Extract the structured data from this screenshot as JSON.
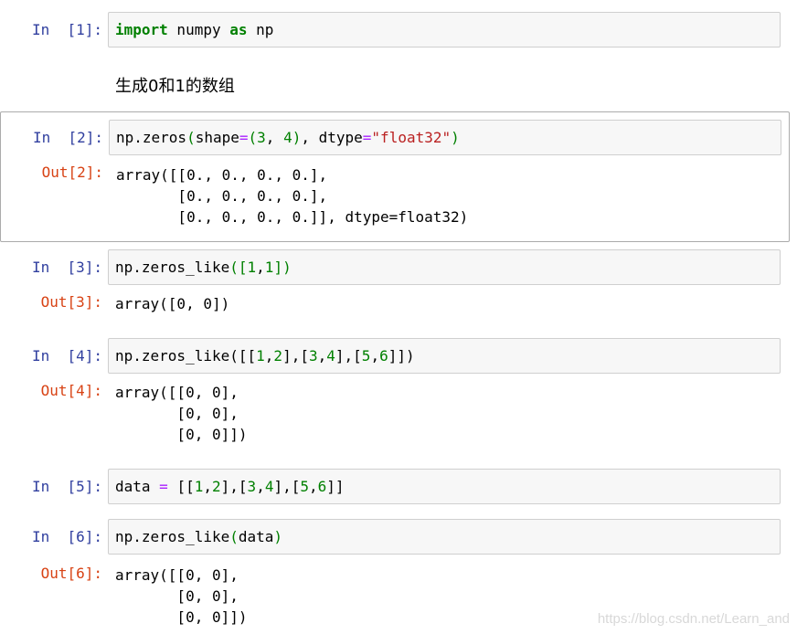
{
  "cells": [
    {
      "prompt": "In  [1]:",
      "code_tokens": [
        {
          "t": "import",
          "c": "kw"
        },
        {
          "t": " numpy ",
          "c": ""
        },
        {
          "t": "as",
          "c": "kw"
        },
        {
          "t": " np",
          "c": ""
        }
      ]
    },
    {
      "markdown": "生成0和1的数组"
    },
    {
      "prompt": "In  [2]:",
      "code_tokens": [
        {
          "t": "np.zeros",
          "c": ""
        },
        {
          "t": "(",
          "c": "paren"
        },
        {
          "t": "shape",
          "c": ""
        },
        {
          "t": "=",
          "c": "op"
        },
        {
          "t": "(",
          "c": "paren"
        },
        {
          "t": "3",
          "c": "num"
        },
        {
          "t": ", ",
          "c": ""
        },
        {
          "t": "4",
          "c": "num"
        },
        {
          "t": ")",
          "c": "paren"
        },
        {
          "t": ", dtype",
          "c": ""
        },
        {
          "t": "=",
          "c": "op"
        },
        {
          "t": "\"float32\"",
          "c": "str"
        },
        {
          "t": ")",
          "c": "paren"
        }
      ],
      "out_prompt": "Out[2]:",
      "output": "array([[0., 0., 0., 0.],\n       [0., 0., 0., 0.],\n       [0., 0., 0., 0.]], dtype=float32)"
    },
    {
      "prompt": "In  [3]:",
      "code_tokens": [
        {
          "t": "np.zeros_like",
          "c": ""
        },
        {
          "t": "(",
          "c": "paren"
        },
        {
          "t": "[",
          "c": "paren"
        },
        {
          "t": "1",
          "c": "num"
        },
        {
          "t": ",",
          "c": ""
        },
        {
          "t": "1",
          "c": "num"
        },
        {
          "t": "]",
          "c": "paren"
        },
        {
          "t": ")",
          "c": "paren"
        }
      ],
      "out_prompt": "Out[3]:",
      "output": "array([0, 0])"
    },
    {
      "prompt": "In  [4]:",
      "code_tokens": [
        {
          "t": "np.zeros_like",
          "c": ""
        },
        {
          "t": "([[",
          "c": ""
        },
        {
          "t": "1",
          "c": "num"
        },
        {
          "t": ",",
          "c": ""
        },
        {
          "t": "2",
          "c": "num"
        },
        {
          "t": "],[",
          "c": ""
        },
        {
          "t": "3",
          "c": "num"
        },
        {
          "t": ",",
          "c": ""
        },
        {
          "t": "4",
          "c": "num"
        },
        {
          "t": "],[",
          "c": ""
        },
        {
          "t": "5",
          "c": "num"
        },
        {
          "t": ",",
          "c": ""
        },
        {
          "t": "6",
          "c": "num"
        },
        {
          "t": "]])",
          "c": ""
        }
      ],
      "out_prompt": "Out[4]:",
      "output": "array([[0, 0],\n       [0, 0],\n       [0, 0]])"
    },
    {
      "prompt": "In  [5]:",
      "code_tokens": [
        {
          "t": "data ",
          "c": ""
        },
        {
          "t": "=",
          "c": "op"
        },
        {
          "t": " [[",
          "c": ""
        },
        {
          "t": "1",
          "c": "num"
        },
        {
          "t": ",",
          "c": ""
        },
        {
          "t": "2",
          "c": "num"
        },
        {
          "t": "],[",
          "c": ""
        },
        {
          "t": "3",
          "c": "num"
        },
        {
          "t": ",",
          "c": ""
        },
        {
          "t": "4",
          "c": "num"
        },
        {
          "t": "],[",
          "c": ""
        },
        {
          "t": "5",
          "c": "num"
        },
        {
          "t": ",",
          "c": ""
        },
        {
          "t": "6",
          "c": "num"
        },
        {
          "t": "]]",
          "c": ""
        }
      ]
    },
    {
      "prompt": "In  [6]:",
      "code_tokens": [
        {
          "t": "np.zeros_like",
          "c": ""
        },
        {
          "t": "(",
          "c": "paren"
        },
        {
          "t": "data",
          "c": ""
        },
        {
          "t": ")",
          "c": "paren"
        }
      ],
      "out_prompt": "Out[6]:",
      "output": "array([[0, 0],\n       [0, 0],\n       [0, 0]])"
    }
  ],
  "watermark": "https://blog.csdn.net/Learn_and",
  "colors": {
    "prompt_in": "#303f9f",
    "prompt_out": "#d84315",
    "input_bg": "#f7f7f7",
    "keyword": "#008000",
    "string": "#ba2121",
    "operator": "#aa22ff"
  }
}
